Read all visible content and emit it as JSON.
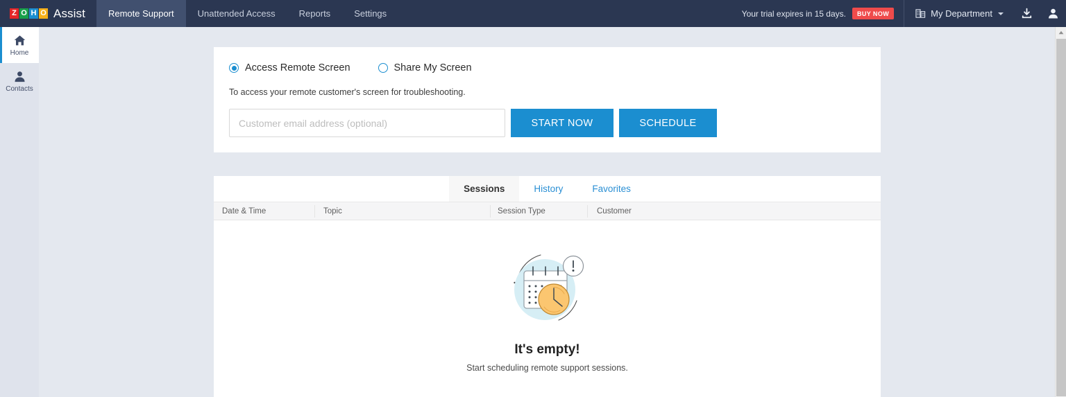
{
  "topbar": {
    "logo_letters": [
      "Z",
      "O",
      "H",
      "O"
    ],
    "brand_name": "Assist",
    "nav": [
      {
        "label": "Remote Support",
        "active": true
      },
      {
        "label": "Unattended Access",
        "active": false
      },
      {
        "label": "Reports",
        "active": false
      },
      {
        "label": "Settings",
        "active": false
      }
    ],
    "trial_text": "Your trial expires in 15 days.",
    "buy_now_label": "BUY NOW",
    "department_label": "My Department",
    "download_icon": "download-icon",
    "profile_icon": "user-icon",
    "colors": {
      "bar_bg": "#2b3752",
      "active_nav_bg": "#41506f",
      "buy_now_bg": "#ef4b4b",
      "logo_z": "#e42527",
      "logo_o1": "#18a04a",
      "logo_h": "#1b8ed0",
      "logo_o2": "#f8b019"
    }
  },
  "sidebar": {
    "items": [
      {
        "label": "Home",
        "icon": "home-icon",
        "active": true
      },
      {
        "label": "Contacts",
        "icon": "contacts-icon",
        "active": false
      }
    ]
  },
  "action_card": {
    "options": [
      {
        "label": "Access Remote Screen",
        "selected": true
      },
      {
        "label": "Share My Screen",
        "selected": false
      }
    ],
    "hint": "To access your remote customer's screen for troubleshooting.",
    "email_placeholder": "Customer email address (optional)",
    "email_value": "",
    "start_now_label": "START NOW",
    "schedule_label": "SCHEDULE",
    "accent_color": "#1b8ed0"
  },
  "sessions_card": {
    "tabs": [
      {
        "label": "Sessions",
        "active": true
      },
      {
        "label": "History",
        "active": false
      },
      {
        "label": "Favorites",
        "active": false
      }
    ],
    "columns": [
      "Date & Time",
      "Topic",
      "Session Type",
      "Customer"
    ],
    "rows": [],
    "empty_state": {
      "illustration": "calendar-clock-alert-illustration",
      "title": "It's empty!",
      "subtitle": "Start scheduling remote support sessions.",
      "circle_color": "#d6eef5",
      "clock_color": "#fbc670"
    }
  },
  "scrollbar": {
    "up_arrow_icon": "caret-up-icon"
  }
}
